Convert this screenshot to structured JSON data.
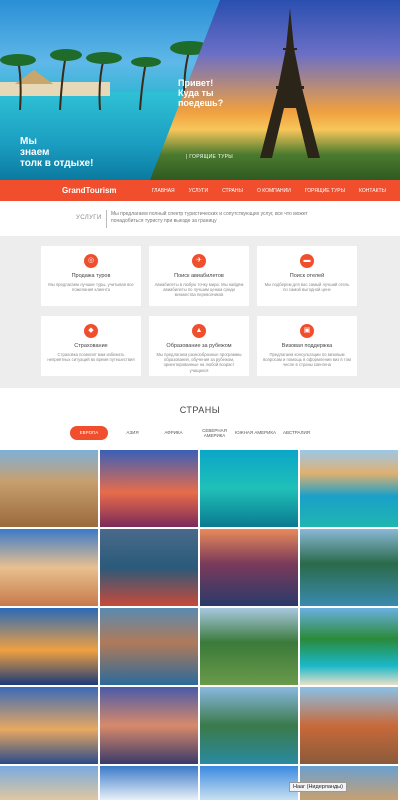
{
  "hero": {
    "caption_left": [
      "Мы",
      "знаем",
      "толк в отдыхе!"
    ],
    "caption_right": [
      "Привет!",
      "Куда ты",
      "поедешь?"
    ],
    "hot_tours_label": "| ГОРЯЩИЕ ТУРЫ"
  },
  "nav": {
    "brand": "GrandTourism",
    "items": [
      "ГЛАВНАЯ",
      "УСЛУГИ",
      "СТРАНЫ",
      "О КОМПАНИИ",
      "ГОРЯЩИЕ ТУРЫ",
      "КОНТАКТЫ"
    ]
  },
  "intro": {
    "title": "УСЛУГИ",
    "text": "Мы предлагаем полный спектр туристических и сопутствующих услуг, все что может понадобиться туристу при выезде за границу"
  },
  "services": [
    {
      "icon": "globe-icon",
      "glyph": "◎",
      "title": "Продажа туров",
      "text": "Мы предлагаем лучшие туры, учитывая все пожелания клиента"
    },
    {
      "icon": "plane-icon",
      "glyph": "✈",
      "title": "Поиск авиабилетов",
      "text": "Авиабилеты в любую точку мира. Мы найдём авиабилеты по лучшим ценам среди множества перевозчиков"
    },
    {
      "icon": "bed-icon",
      "glyph": "▬",
      "title": "Поиск отелей",
      "text": "Мы подберем для вас самый лучший отель по самой выгодной цене"
    },
    {
      "icon": "shield-icon",
      "glyph": "◆",
      "title": "Страхование",
      "text": "Страховка позволит вам избежать неприятных ситуаций во время путешествия"
    },
    {
      "icon": "graduation-icon",
      "glyph": "▲",
      "title": "Образование за рубежом",
      "text": "Мы предлагаем разнообразные программы образования, обучения за рубежом, ориентированные на любой возраст учащихся"
    },
    {
      "icon": "passport-icon",
      "glyph": "▣",
      "title": "Визовая поддержка",
      "text": "Предлагаем консультации по визовым вопросам и помощь в оформлении виз в том числе в страны Шенгена"
    }
  ],
  "countries": {
    "title": "СТРАНЫ",
    "tabs": [
      "ЕВРОПА",
      "АЗИЯ",
      "АФРИКА",
      "СЕВЕРНАЯ АМЕРИКА",
      "ЮЖНАЯ АМЕРИКА",
      "АВСТРАЛИЯ"
    ],
    "active_tab": "ЕВРОПА"
  },
  "tooltip": "Нааг (Нидерланды)",
  "colors": {
    "accent": "#f04e2c",
    "services_bg": "#ededed"
  }
}
